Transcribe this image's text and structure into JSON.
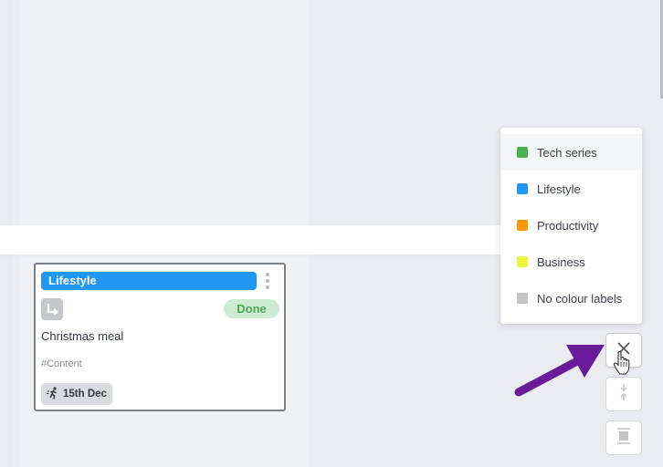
{
  "card": {
    "label": "Lifestyle",
    "label_color": "#2196f3",
    "status": "Done",
    "title": "Christmas meal",
    "tag": "#Content",
    "due_date": "15th Dec",
    "icons": {
      "menu": "kebab-menu-icon",
      "subtask": "subtask-arrow-icon",
      "due": "running-person-icon"
    }
  },
  "label_dropdown": {
    "items": [
      {
        "label": "Tech series",
        "color": "#4caf50"
      },
      {
        "label": "Lifestyle",
        "color": "#2196f3"
      },
      {
        "label": "Productivity",
        "color": "#ff9800"
      },
      {
        "label": "Business",
        "color": "#eef53c"
      },
      {
        "label": "No colour labels",
        "color": "#c2c4c8"
      }
    ],
    "hovered_index": 0
  },
  "side_toolbar": {
    "buttons": [
      {
        "name": "close",
        "icon": "close-icon"
      },
      {
        "name": "collapse",
        "icon": "collapse-icon"
      },
      {
        "name": "expand",
        "icon": "expand-icon"
      }
    ]
  },
  "annotation": {
    "arrow_color": "#6a1b9a"
  }
}
